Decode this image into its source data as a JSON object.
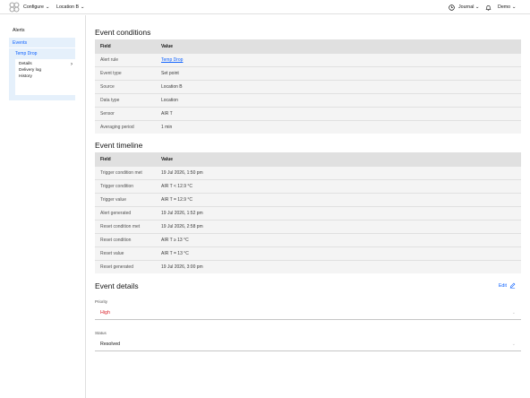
{
  "header": {
    "configure": "Configure",
    "location": "Location B",
    "journal": "Journal",
    "user": "Demo"
  },
  "sidebar": {
    "alerts": "Alerts",
    "events": "Events",
    "group_title": "Temp Drop",
    "sub_items": [
      "Details",
      "Delivery log",
      "History"
    ]
  },
  "conditions": {
    "title": "Event conditions",
    "col_field": "Field",
    "col_value": "Value",
    "rows": [
      {
        "field": "Alert rule",
        "value": "Temp Drop"
      },
      {
        "field": "Event type",
        "value": "Set point"
      },
      {
        "field": "Source",
        "value": "Location B"
      },
      {
        "field": "Data type",
        "value": "Location"
      },
      {
        "field": "Sensor",
        "value": "AIR T"
      },
      {
        "field": "Averaging period",
        "value": "1 min"
      }
    ]
  },
  "timeline": {
    "title": "Event timeline",
    "col_field": "Field",
    "col_value": "Value",
    "rows": [
      {
        "field": "Trigger condition met",
        "value": "19 Jul 2026, 1:50 pm"
      },
      {
        "field": "Trigger condition",
        "value": "AIR T < 12.9 °C"
      },
      {
        "field": "Trigger value",
        "value": "AIR T = 12.9 °C"
      },
      {
        "field": "Alert generated",
        "value": "19 Jul 2026, 1:52 pm"
      },
      {
        "field": "Reset condition met",
        "value": "19 Jul 2026, 2:58 pm"
      },
      {
        "field": "Reset condition",
        "value": "AIR T ≥ 13 °C"
      },
      {
        "field": "Reset value",
        "value": "AIR T = 13 °C"
      },
      {
        "field": "Reset generated",
        "value": "19 Jul 2026, 3:00 pm"
      }
    ]
  },
  "details": {
    "title": "Event details",
    "edit": "Edit",
    "priority_label": "Priority",
    "priority_value": "High",
    "status_label": "Status",
    "status_value": "Resolved"
  },
  "colors": {
    "accent": "#0f62fe",
    "priority_high": "#da1e28",
    "nav_selected_bg": "#e5f0fb"
  }
}
